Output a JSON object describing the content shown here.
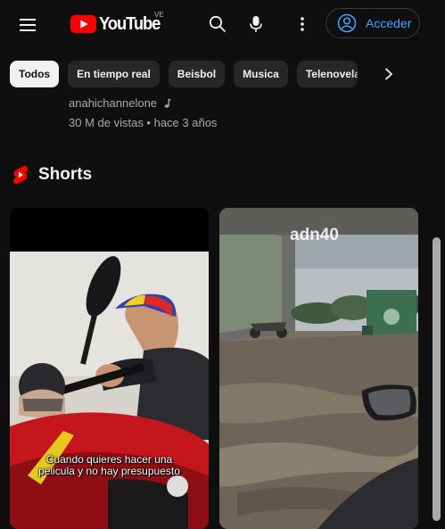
{
  "header": {
    "logo_text": "YouTube",
    "country_code": "VE",
    "sign_in_label": "Acceder",
    "icons": [
      "menu-icon",
      "search-icon",
      "microphone-icon",
      "more-vert-icon",
      "account-circle-icon"
    ]
  },
  "chips": {
    "items": [
      {
        "label": "Todos",
        "selected": true
      },
      {
        "label": "En tiempo real",
        "selected": false
      },
      {
        "label": "Beisbol",
        "selected": false
      },
      {
        "label": "Musica",
        "selected": false
      },
      {
        "label": "Telenovelas",
        "selected": false
      }
    ],
    "next_icon": "chevron-right-icon"
  },
  "video": {
    "channel": "anahichannelone",
    "channel_badge_icon": "music-note-icon",
    "views_line": "30 M de vistas • hace 3 años"
  },
  "shorts": {
    "title": "Shorts",
    "icon": "shorts-icon",
    "cards": [
      {
        "caption_line1": "Cuando quieres hacer una",
        "caption_line2": "pelicula y no hay presupuesto"
      },
      {
        "watermark": "adn40"
      }
    ]
  },
  "colors": {
    "background": "#0f0f0f",
    "chip_bg": "#272727",
    "accent_blue": "#3ea6ff",
    "youtube_red": "#ff0000"
  }
}
